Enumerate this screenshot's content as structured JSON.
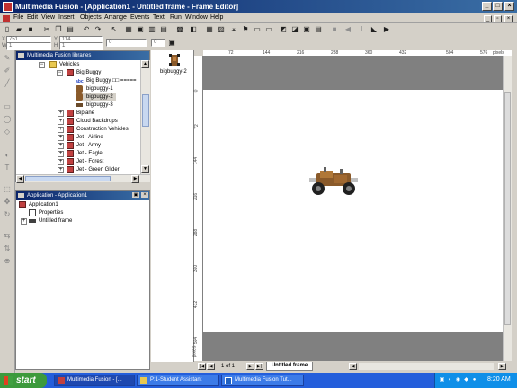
{
  "window": {
    "title": "Multimedia Fusion - [Application1 - Untitled frame - Frame Editor]",
    "controls": [
      "_",
      "□",
      "×"
    ]
  },
  "menu": [
    "File",
    "Edit",
    "View",
    "Insert",
    "Objects",
    "Arrange",
    "Events",
    "Text",
    "Run",
    "Window",
    "Help"
  ],
  "toolbar2": {
    "x_value": "751",
    "y_value": "114",
    "w_value": "1",
    "h_value": "1",
    "field5_value": "0",
    "field6_value": "0",
    "x_label": "X",
    "y_label": "Y",
    "w_label": "W",
    "h_label": "H"
  },
  "libraries": {
    "title": "Multimedia Fusion libraries",
    "items": [
      {
        "label": "Vehicles",
        "icon": "folder-icon"
      },
      {
        "label": "Big Buggy",
        "icon": "folder-icon"
      },
      {
        "label": "Big Buggy □□ =====",
        "icon": "text-object-icon"
      },
      {
        "label": "bigbuggy-1",
        "icon": "buggy-icon"
      },
      {
        "label": "bigbuggy-2",
        "icon": "buggy-icon",
        "selected": true
      },
      {
        "label": "bigbuggy-3",
        "icon": "buggy-icon"
      },
      {
        "label": "Biplane",
        "icon": "library-icon"
      },
      {
        "label": "Cloud Backdrops",
        "icon": "library-icon"
      },
      {
        "label": "Construction Vehicles",
        "icon": "library-icon"
      },
      {
        "label": "Jet - Airline",
        "icon": "library-icon"
      },
      {
        "label": "Jet - Army",
        "icon": "library-icon"
      },
      {
        "label": "Jet - Eagle",
        "icon": "library-icon"
      },
      {
        "label": "Jet - Forest",
        "icon": "library-icon"
      },
      {
        "label": "Jet - Green Glider",
        "icon": "library-icon"
      }
    ]
  },
  "preview": {
    "label": "bigbuggy-2"
  },
  "application_panel": {
    "title": "Application - Application1",
    "items": [
      {
        "label": "Application1"
      },
      {
        "label": "Properties"
      },
      {
        "label": "Untitled frame"
      }
    ]
  },
  "ruler": {
    "h_ticks": [
      "72",
      "144",
      "216",
      "288",
      "360",
      "432",
      "504",
      "576"
    ],
    "h_unit": "pixels",
    "v_ticks": [
      "0",
      "72",
      "144",
      "216",
      "288",
      "360",
      "432",
      "504"
    ],
    "v_unit": "pixels"
  },
  "frame_tabs": {
    "page_indicator": "1 of 1",
    "tab_label": "Untitled frame"
  },
  "taskbar": {
    "start_label": "start",
    "items": [
      {
        "label": "Multimedia Fusion - [...",
        "active": true
      },
      {
        "label": "P:1-Student Assistant",
        "active": false
      },
      {
        "label": "Multimedia Fusion Tut...",
        "active": false
      }
    ],
    "clock": "8:20 AM"
  },
  "colors": {
    "title_bar": "#0a246a",
    "taskbar": "#245edb",
    "start": "#3c9a3c",
    "frame_border_band": "#808080"
  }
}
